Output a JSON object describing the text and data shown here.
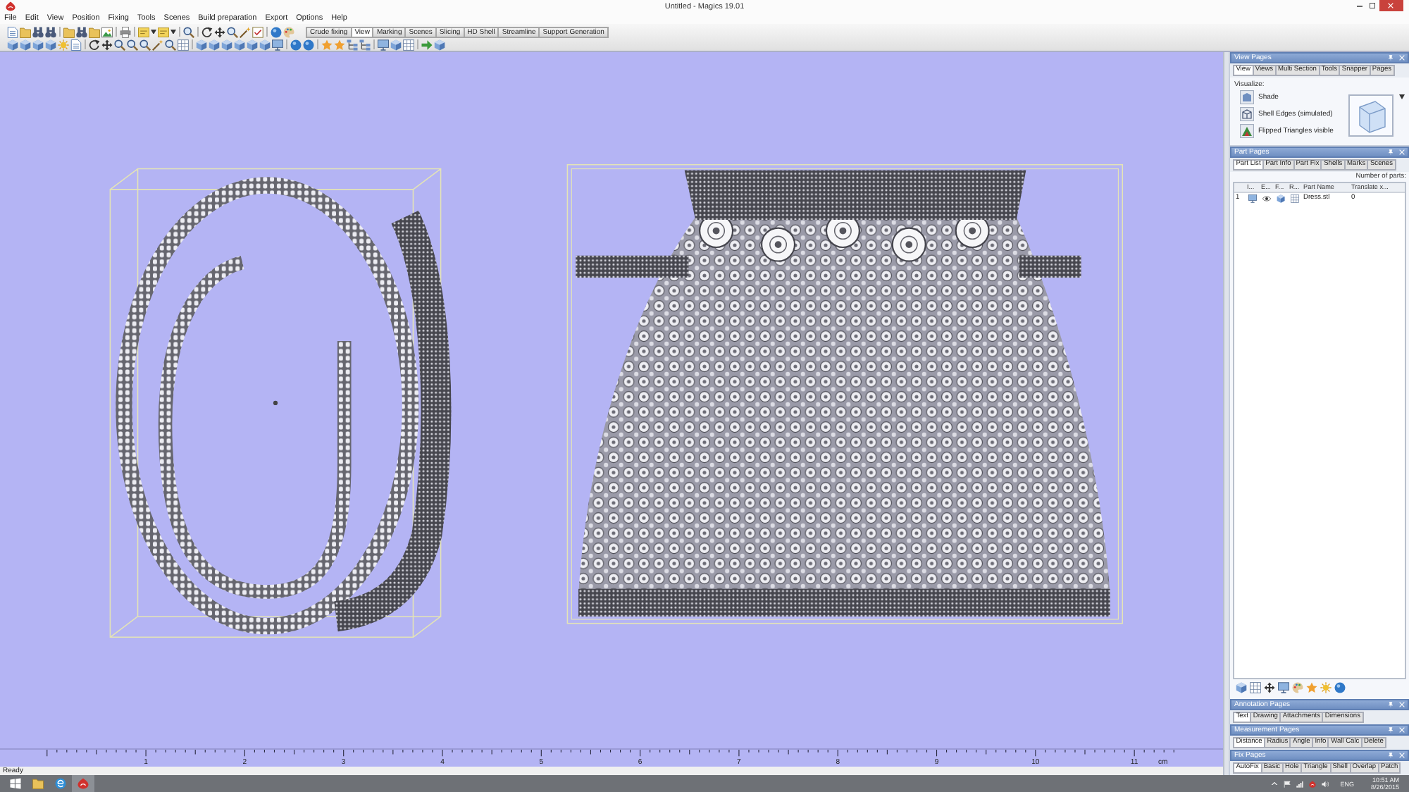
{
  "window": {
    "title": "Untitled - Magics 19.01"
  },
  "menu": [
    "File",
    "Edit",
    "View",
    "Position",
    "Fixing",
    "Tools",
    "Scenes",
    "Build preparation",
    "Export",
    "Options",
    "Help"
  ],
  "toolbar_tabs": [
    {
      "label": "Crude fixing",
      "selected": false
    },
    {
      "label": "View",
      "selected": true
    },
    {
      "label": "Marking",
      "selected": false
    },
    {
      "label": "Scenes",
      "selected": false
    },
    {
      "label": "Slicing",
      "selected": false
    },
    {
      "label": "HD Shell",
      "selected": false
    },
    {
      "label": "Streamline",
      "selected": false
    },
    {
      "label": "Support Generation",
      "selected": false
    }
  ],
  "viewport": {
    "parts": [
      {
        "kind": "spiral"
      },
      {
        "kind": "dress"
      }
    ],
    "ruler": {
      "labels": [
        "1",
        "2",
        "3",
        "4",
        "5",
        "6",
        "7",
        "8",
        "9",
        "10",
        "11"
      ],
      "unit": "cm"
    }
  },
  "status_bar": {
    "text": "Ready"
  },
  "side_panels": [
    {
      "kind": "view",
      "title": "View Pages",
      "tabs": [
        {
          "label": "View",
          "selected": true
        },
        {
          "label": "Views",
          "selected": false
        },
        {
          "label": "Multi Section",
          "selected": false
        },
        {
          "label": "Tools",
          "selected": false
        },
        {
          "label": "Snapper",
          "selected": false
        },
        {
          "label": "Pages",
          "selected": false
        }
      ],
      "group_label": "Visualize:",
      "buttons": [
        "Shade",
        "Shell Edges (simulated)",
        "Flipped Triangles visible"
      ]
    },
    {
      "kind": "parts",
      "title": "Part Pages",
      "tabs": [
        {
          "label": "Part List",
          "selected": true
        },
        {
          "label": "Part Info",
          "selected": false
        },
        {
          "label": "Part Fix",
          "selected": false
        },
        {
          "label": "Shells",
          "selected": false
        },
        {
          "label": "Marks",
          "selected": false
        },
        {
          "label": "Scenes",
          "selected": false
        }
      ],
      "count_label": "Number of parts:",
      "columns": [
        "I...",
        "E...",
        "F...",
        "R...",
        "Part Name",
        "Translate x..."
      ],
      "rows": [
        {
          "number": "1",
          "name": "Dress.stl",
          "value": "0"
        }
      ]
    },
    {
      "kind": "tabs",
      "title": "Annotation Pages",
      "tabs": [
        {
          "label": "Text",
          "selected": true
        },
        {
          "label": "Drawing",
          "selected": false
        },
        {
          "label": "Attachments",
          "selected": false
        },
        {
          "label": "Dimensions",
          "selected": false
        }
      ]
    },
    {
      "kind": "tabs",
      "title": "Measurement Pages",
      "tabs": [
        {
          "label": "Distance",
          "selected": true
        },
        {
          "label": "Radius",
          "selected": false
        },
        {
          "label": "Angle",
          "selected": false
        },
        {
          "label": "Info",
          "selected": false
        },
        {
          "label": "Wall Calc",
          "selected": false
        },
        {
          "label": "Delete",
          "selected": false
        }
      ]
    },
    {
      "kind": "tabs",
      "title": "Fix Pages",
      "tabs": [
        {
          "label": "AutoFix",
          "selected": true
        },
        {
          "label": "Basic",
          "selected": false
        },
        {
          "label": "Hole",
          "selected": false
        },
        {
          "label": "Triangle",
          "selected": false
        },
        {
          "label": "Shell",
          "selected": false
        },
        {
          "label": "Overlap",
          "selected": false
        },
        {
          "label": "Patch",
          "selected": false
        }
      ]
    }
  ],
  "taskbar": {
    "language": "ENG",
    "time": "10:51 AM",
    "date": "8/26/2015"
  }
}
